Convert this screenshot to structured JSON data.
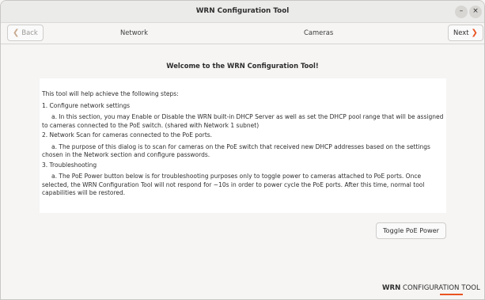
{
  "window": {
    "title": "WRN Configuration Tool",
    "minimize_glyph": "–",
    "close_glyph": "×"
  },
  "navbar": {
    "back_label": "Back",
    "back_icon": "chevron-left-icon",
    "tabs": [
      {
        "label": "Network"
      },
      {
        "label": "Cameras"
      }
    ],
    "next_label": "Next",
    "next_icon": "chevron-right-icon",
    "accent_color": "#e95420"
  },
  "main": {
    "heading": "Welcome to the WRN Configuration Tool!",
    "intro": "This tool will help achieve the following steps:",
    "steps": [
      {
        "title": "1.   Configure network settings",
        "detail": "a.   In this section, you may Enable or Disable the WRN built-in DHCP Server as well as set the DHCP pool range that will be assigned to cameras connected to the PoE switch. (shared with Network 1 subnet)"
      },
      {
        "title": "2.   Network Scan for cameras connected to the PoE ports.",
        "detail": "a.   The purpose of this dialog is to scan for cameras on the PoE switch that received new DHCP addresses based on the settings chosen in the Network section and configure passwords."
      },
      {
        "title": "3.   Troubleshooting",
        "detail": "a.   The PoE Power button below is for troubleshooting purposes only to toggle power to cameras attached to PoE ports.  Once selected, the WRN Configuration Tool will not respond for ~10s in order to power cycle the PoE ports.  After this time, normal tool capabilities will be restored."
      }
    ],
    "toggle_poe_label": "Toggle PoE Power"
  },
  "footer": {
    "brand_bold": "WRN",
    "brand_rest": " CONFIGURATION TOOL"
  }
}
